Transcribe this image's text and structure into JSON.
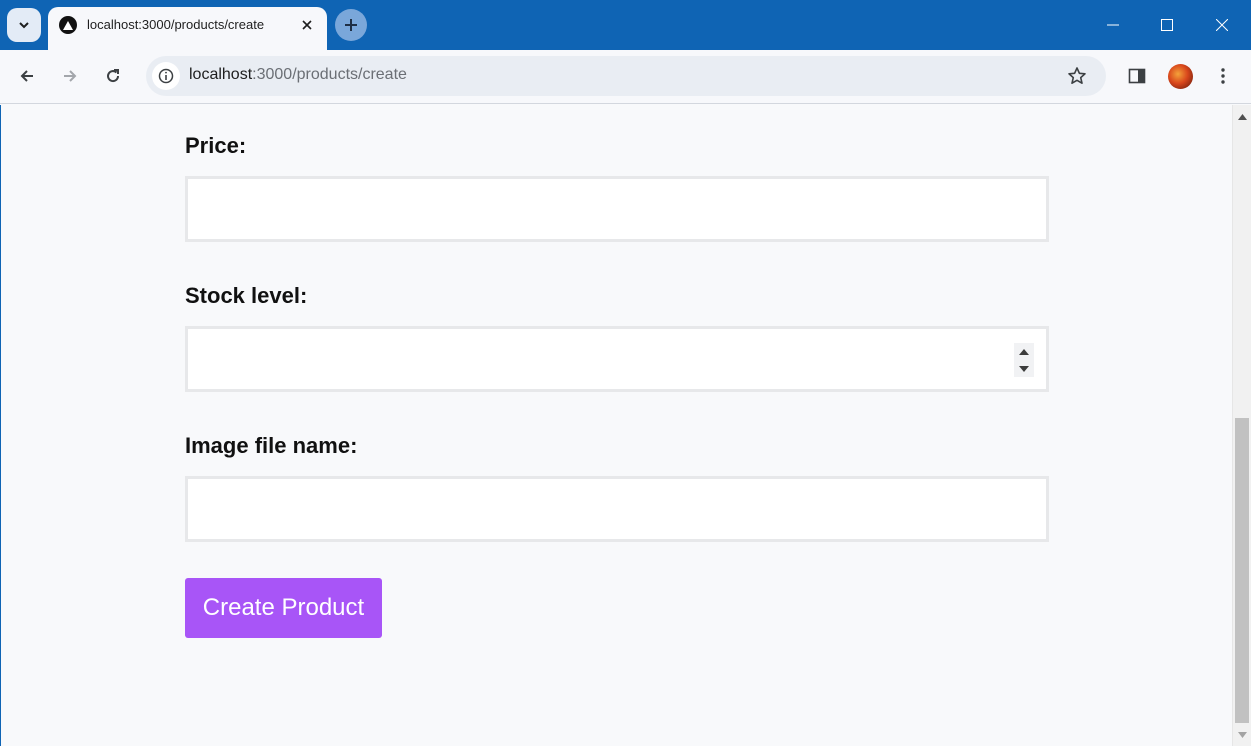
{
  "browser": {
    "tab_title": "localhost:3000/products/create",
    "url_host": "localhost",
    "url_path": ":3000/products/create",
    "accent_color": "#0f64b4"
  },
  "form": {
    "fields": [
      {
        "label": "Price:",
        "value": "",
        "type": "text"
      },
      {
        "label": "Stock level:",
        "value": "",
        "type": "number"
      },
      {
        "label": "Image file name:",
        "value": "",
        "type": "text"
      }
    ],
    "submit_label": "Create Product",
    "submit_color": "#a855f7"
  },
  "icons": {
    "tab_search": "chevron-down-icon",
    "favicon": "triangle-logo-icon",
    "tab_close": "close-icon",
    "new_tab": "plus-icon",
    "back": "arrow-left-icon",
    "forward": "arrow-right-icon",
    "reload": "reload-icon",
    "site_info": "info-icon",
    "bookmark": "star-icon",
    "side_panel": "side-panel-icon",
    "menu": "kebab-menu-icon"
  }
}
